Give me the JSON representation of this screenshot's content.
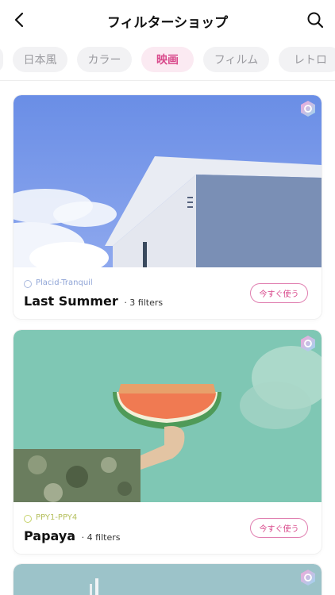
{
  "header": {
    "title": "フィルターショップ",
    "back_icon": "chevron-left-icon",
    "search_icon": "search-icon"
  },
  "tabs": [
    {
      "label": "日本風",
      "active": false
    },
    {
      "label": "カラー",
      "active": false
    },
    {
      "label": "映画",
      "active": true
    },
    {
      "label": "フィルム",
      "active": false
    },
    {
      "label": "レトロ",
      "active": false
    }
  ],
  "cards": [
    {
      "tagline": "Placid-Tranquil",
      "tag_color": "#a9b9de",
      "name": "Last Summer",
      "count": "· 3 filters",
      "button": "今すぐ使う"
    },
    {
      "tagline": "PPY1-PPY4",
      "tag_color": "#c6d36b",
      "name": "Papaya",
      "count": "· 4 filters",
      "button": "今すぐ使う"
    }
  ],
  "colors": {
    "accent": "#d94a8c",
    "accent_bg": "#fbeaf2"
  }
}
